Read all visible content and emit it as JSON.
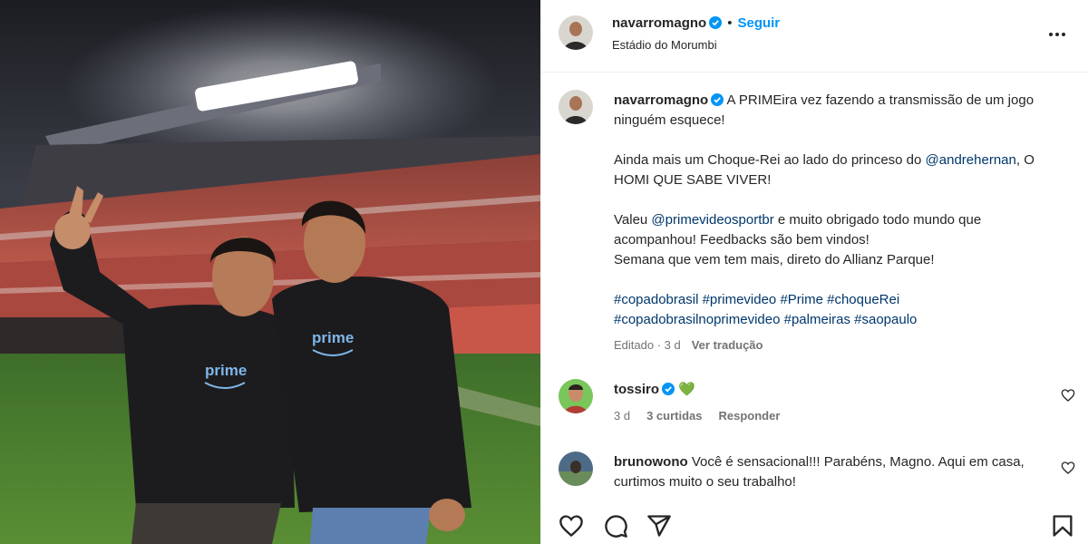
{
  "post": {
    "username": "navarromagno",
    "follow_label": "Seguir",
    "location": "Estádio do Morumbi",
    "icons": {
      "more": "more-options-icon",
      "verified": "verified-badge-icon"
    }
  },
  "caption": {
    "username": "navarromagno",
    "line1": "A PRIMEira vez fazendo a transmissão de um jogo ninguém esquece!",
    "line2_a": "Ainda mais um Choque-Rei ao lado do princeso do ",
    "line2_mention": "@andrehernan",
    "line2_b": ", O HOMI QUE SABE VIVER!",
    "line3_a": "Valeu ",
    "line3_mention": "@primevideosportbr",
    "line3_b": " e muito obrigado todo mundo que acompanhou! Feedbacks são bem vindos!",
    "line4": "Semana que vem tem mais, direto do Allianz Parque!",
    "hashtags1": "#copadobrasil #primevideo #Prime #choqueRei",
    "hashtags2": "#copadobrasilnoprimevideo #palmeiras #saopaulo",
    "edited": "Editado · 3 d",
    "translate": "Ver tradução"
  },
  "comments": [
    {
      "username": "tossiro",
      "text": "💚",
      "time": "3 d",
      "likes": "3 curtidas",
      "reply": "Responder"
    },
    {
      "username": "brunowono",
      "text": "Você é sensacional!!! Parabéns, Magno. Aqui em casa, curtimos muito o seu trabalho!"
    }
  ],
  "actions": {
    "icons": [
      "heart-icon",
      "comment-icon",
      "share-icon",
      "save-icon"
    ]
  },
  "photo": {
    "shirt_text": "prime"
  },
  "colors": {
    "accent": "#0095f6",
    "link": "#00376b",
    "muted": "#737373",
    "text": "#262626",
    "verified": "#0095f6"
  }
}
